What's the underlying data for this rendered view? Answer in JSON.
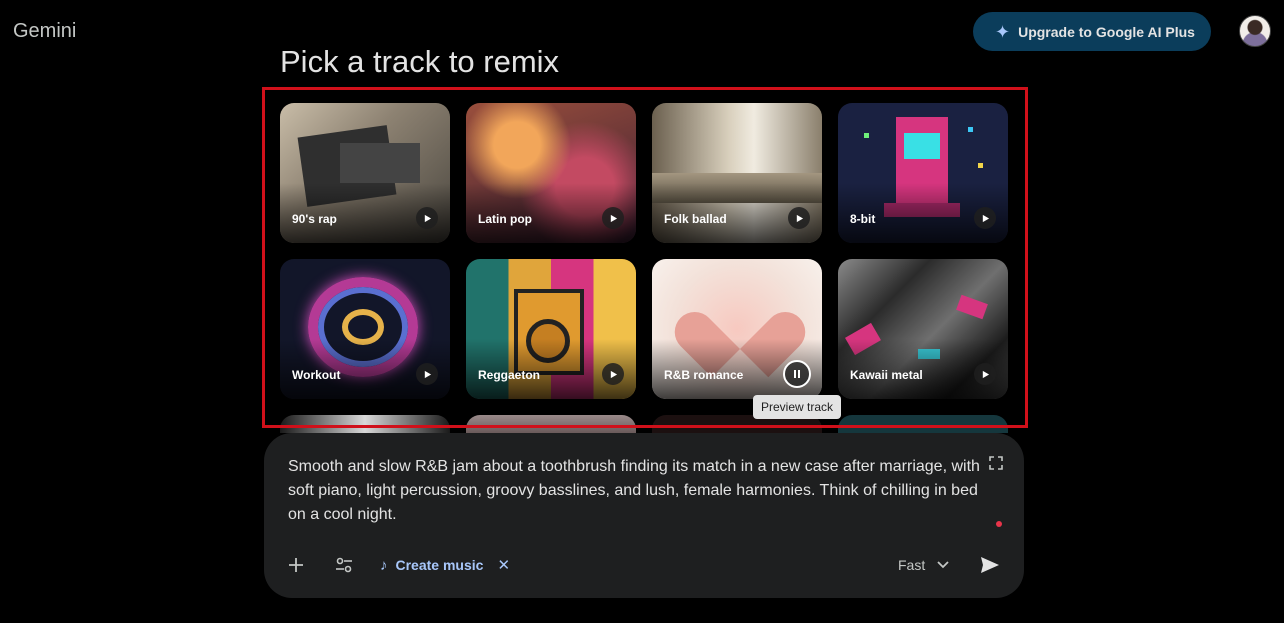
{
  "header": {
    "brand": "Gemini",
    "upgrade_label": "Upgrade to Google AI Plus"
  },
  "page": {
    "heading": "Pick a track to remix"
  },
  "tracks": [
    {
      "label": "90's rap",
      "state": "play",
      "colors": [
        "#a79a86",
        "#3d3a35"
      ]
    },
    {
      "label": "Latin pop",
      "state": "play",
      "colors": [
        "#b06b45",
        "#3a1c2a"
      ]
    },
    {
      "label": "Folk ballad",
      "state": "play",
      "colors": [
        "#d9d2c1",
        "#5e5648"
      ]
    },
    {
      "label": "8-bit",
      "state": "play",
      "colors": [
        "#1c2340",
        "#d6357f"
      ]
    },
    {
      "label": "Workout",
      "state": "play",
      "colors": [
        "#151a2e",
        "#b43a95"
      ]
    },
    {
      "label": "Reggaeton",
      "state": "play",
      "colors": [
        "#e0a53b",
        "#21736b"
      ]
    },
    {
      "label": "R&B romance",
      "state": "pause",
      "colors": [
        "#f5e3dc",
        "#e89a92"
      ]
    },
    {
      "label": "Kawaii metal",
      "state": "play",
      "colors": [
        "#7b7b7b",
        "#1e1e1e"
      ]
    }
  ],
  "tooltip": "Preview track",
  "composer": {
    "prompt_text": "Smooth and slow R&B jam about a toothbrush finding its match in a new case after marriage, with soft piano, light percussion, groovy basslines, and lush, female harmonies. Think of chilling in bed on a cool night.",
    "tool_chip_label": "Create music",
    "mode_label": "Fast"
  },
  "accent": {
    "blue": "#a8c7fa",
    "highlight_border": "#d0101a",
    "record": "#e8344a"
  }
}
